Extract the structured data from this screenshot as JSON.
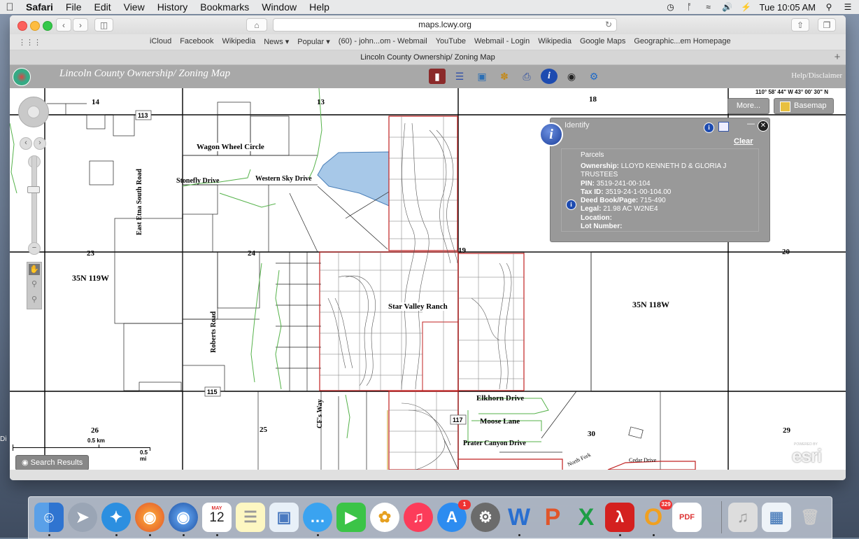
{
  "menubar": {
    "app_name": "Safari",
    "menus": [
      "File",
      "Edit",
      "View",
      "History",
      "Bookmarks",
      "Window",
      "Help"
    ],
    "clock": "Tue 10:05 AM",
    "status_icons": [
      "time-machine-icon",
      "bluetooth-icon",
      "wifi-icon",
      "volume-icon",
      "battery-icon",
      "spotlight-icon",
      "notification-center-icon"
    ]
  },
  "safari": {
    "url": "maps.lcwy.org",
    "bookmarks": [
      "iCloud",
      "Facebook",
      "Wikipedia",
      "News ▾",
      "Popular ▾",
      "(60) - john...om - Webmail",
      "YouTube",
      "Webmail - Login",
      "Wikipedia",
      "Google Maps",
      "Geographic...em Homepage"
    ],
    "tab_title": "Lincoln County Ownership/ Zoning Map"
  },
  "app": {
    "title": "Lincoln County Ownership/ Zoning Map",
    "help": "Help/Disclaimer",
    "tools": [
      "book-icon",
      "list-icon",
      "layers-icon",
      "palette-icon",
      "print-icon",
      "info-icon",
      "binoculars-icon",
      "robot-icon"
    ]
  },
  "map": {
    "coordinates": "110° 58' 44\" W 43° 00' 30\" N",
    "more_button": "More...",
    "basemap_button": "Basemap",
    "search_results": "Search Results",
    "scalebar": {
      "km": "0.5 km",
      "mi": "0.5 mi"
    },
    "section_labels": {
      "s14": "14",
      "s13": "13",
      "s18": "18",
      "s23": "23",
      "s24": "24",
      "s19": "19",
      "s20": "20",
      "s26": "26",
      "s25": "25",
      "s30": "30",
      "s29": "29"
    },
    "township_labels": {
      "west": "35N 119W",
      "east": "35N 118W"
    },
    "road_labels": {
      "wagon_wheel": "Wagon Wheel Circle",
      "stonefly": "Stonefly Drive",
      "western_sky": "Western Sky Drive",
      "east_etna": "East Etna South Road",
      "roberts": "Roberts Road",
      "star_valley": "Star Valley Ranch",
      "elkhorn": "Elkhorn Drive",
      "moose": "Moose Lane",
      "prater": "Prater Canyon Drive",
      "cfs_way": "CF's Way",
      "cedar": "Cedar Drive",
      "north_fork": "North Fork"
    },
    "shields": {
      "h113": "113",
      "h115": "115",
      "h117": "117"
    },
    "watermark": "esri",
    "watermark_tag": "POWERED BY"
  },
  "identify": {
    "title": "Identify",
    "clear": "Clear",
    "layer": "Parcels",
    "fields": [
      {
        "label": "Ownership:",
        "value": "LLOYD KENNETH D & GLORIA J TRUSTEES"
      },
      {
        "label": "PIN:",
        "value": "3519-241-00-104"
      },
      {
        "label": "Tax ID:",
        "value": "3519-24-1-00-104.00"
      },
      {
        "label": "Deed Book/Page:",
        "value": "715-490"
      },
      {
        "label": "Legal:",
        "value": "21.98 AC W2NE4"
      },
      {
        "label": "Location:",
        "value": ""
      },
      {
        "label": "Lot Number:",
        "value": ""
      }
    ]
  },
  "dock": {
    "calendar_month": "MAY",
    "calendar_day": "12",
    "appstore_badge": "1",
    "office_badge": "329",
    "pdf_label": "PDF"
  },
  "desktop": {
    "left_edge_text": "Di"
  }
}
